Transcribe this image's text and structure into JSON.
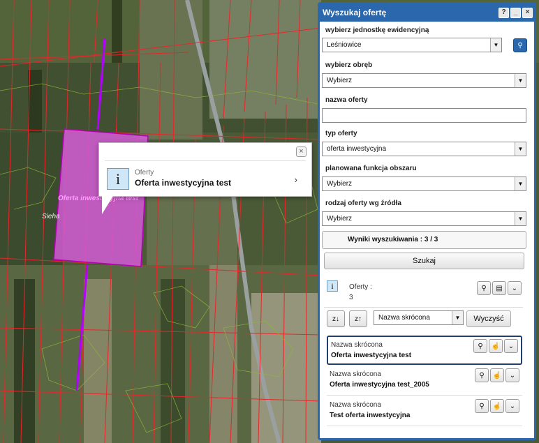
{
  "map": {
    "parcel_label": "Oferta inwestycyjna test",
    "place_label": "Sieha"
  },
  "popup": {
    "type": "Oferty",
    "title": "Oferta inwestycyjna test",
    "close": "×",
    "arrow": "›"
  },
  "panel": {
    "title": "Wyszukaj ofertę",
    "help": "?",
    "minimize": "_",
    "close": "×",
    "fields": {
      "jednostka_label": "wybierz jednostkę ewidencyjną",
      "jednostka_value": "Leśniowice",
      "obreb_label": "wybierz obręb",
      "obreb_value": "Wybierz",
      "nazwa_label": "nazwa oferty",
      "nazwa_value": "",
      "typ_label": "typ oferty",
      "typ_value": "oferta inwestycyjna",
      "funkcja_label": "planowana funkcja obszaru",
      "funkcja_value": "Wybierz",
      "zrodlo_label": "rodzaj oferty wg źródła",
      "zrodlo_value": "Wybierz"
    },
    "results_label": "Wyniki wyszukiwania : 3 / 3",
    "search_button": "Szukaj",
    "info": {
      "label": "Oferty :",
      "count": "3"
    },
    "sort": {
      "field": "Nazwa skrócona",
      "clear_button": "Wyczyść"
    },
    "results": [
      {
        "label": "Nazwa skrócona",
        "title": "Oferta inwestycyjna test"
      },
      {
        "label": "Nazwa skrócona",
        "title": "Oferta inwestycyjna test_2005"
      },
      {
        "label": "Nazwa skrócona",
        "title": "Test oferta inwestycyjna"
      }
    ]
  },
  "colors": {
    "panel_blue": "#2a67ad",
    "parcel_magenta": "#d35bd6",
    "boundary_red": "#e8262a"
  }
}
